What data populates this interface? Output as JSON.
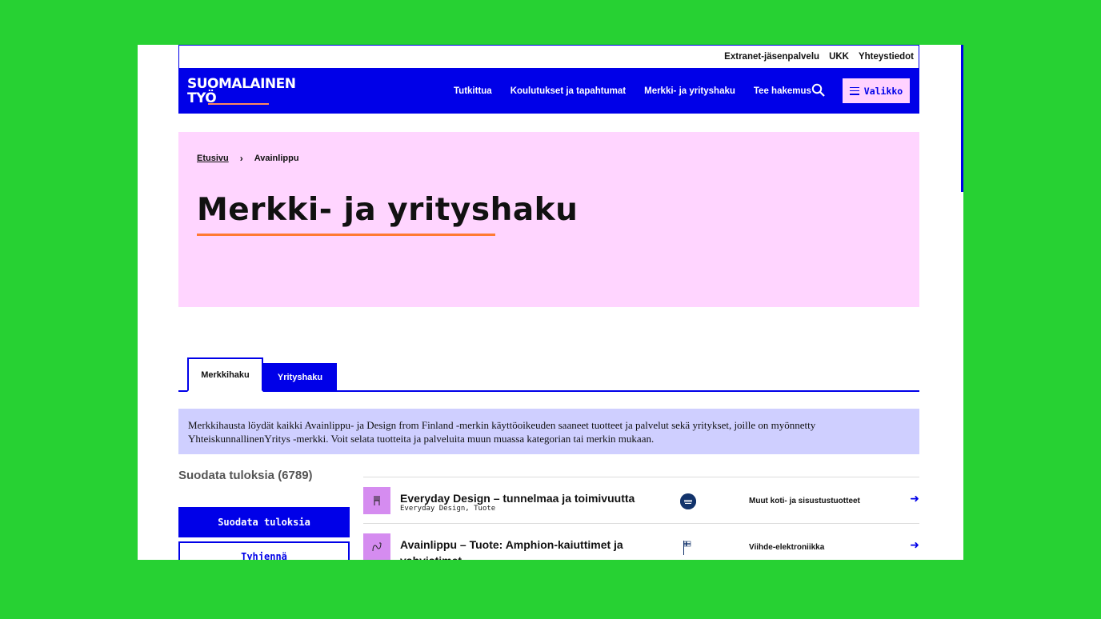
{
  "utility_links": [
    "Extranet-jäsenpalvelu",
    "UKK",
    "Yhteystiedot"
  ],
  "logo": {
    "line1": "SUOMALAINEN",
    "line2": "TYÖ"
  },
  "nav": {
    "items": [
      "Tutkittua",
      "Koulutukset ja tapahtumat",
      "Merkki- ja yrityshaku",
      "Tee hakemus"
    ],
    "menu_label": "Valikko"
  },
  "breadcrumb": {
    "home": "Etusivu",
    "separator": "›",
    "current": "Avainlippu"
  },
  "hero": {
    "title": "Merkki- ja yrityshaku"
  },
  "tabs": {
    "active": "Merkkihaku",
    "inactive": "Yrityshaku"
  },
  "info_text": "Merkkihausta löydät kaikki Avainlippu- ja Design from Finland -merkin käyttöoikeuden saaneet tuotteet ja palvelut sekä yritykset, joille on myönnetty YhteiskunnallinenYritys -merkki. Voit selata tuotteita ja palveluita muun muassa kategorian tai merkin mukaan.",
  "filters": {
    "title": "Suodata tuloksia (6789)",
    "apply_label": "Suodata tuloksia",
    "clear_label": "Tyhjennä"
  },
  "results": [
    {
      "title": "Everyday Design – tunnelmaa ja toimivuutta",
      "subtitle": "Everyday Design, Tuote",
      "category": "Muut koti- ja sisustustuotteet",
      "icon": "chair-icon",
      "badge": "design-from-finland-badge"
    },
    {
      "title": "Avainlippu – Tuote: Amphion-kaiuttimet ja vahvistimet",
      "subtitle": "",
      "category": "Viihde-elektroniikka",
      "icon": "speaker-icon",
      "badge": "avainlippu-flag-badge"
    }
  ],
  "colors": {
    "brand_blue": "#0000e8",
    "hero_pink": "#ffd5ff",
    "info_lavender": "#cfcfff",
    "accent_orange": "#ff7a33",
    "frame_green": "#27d133"
  }
}
